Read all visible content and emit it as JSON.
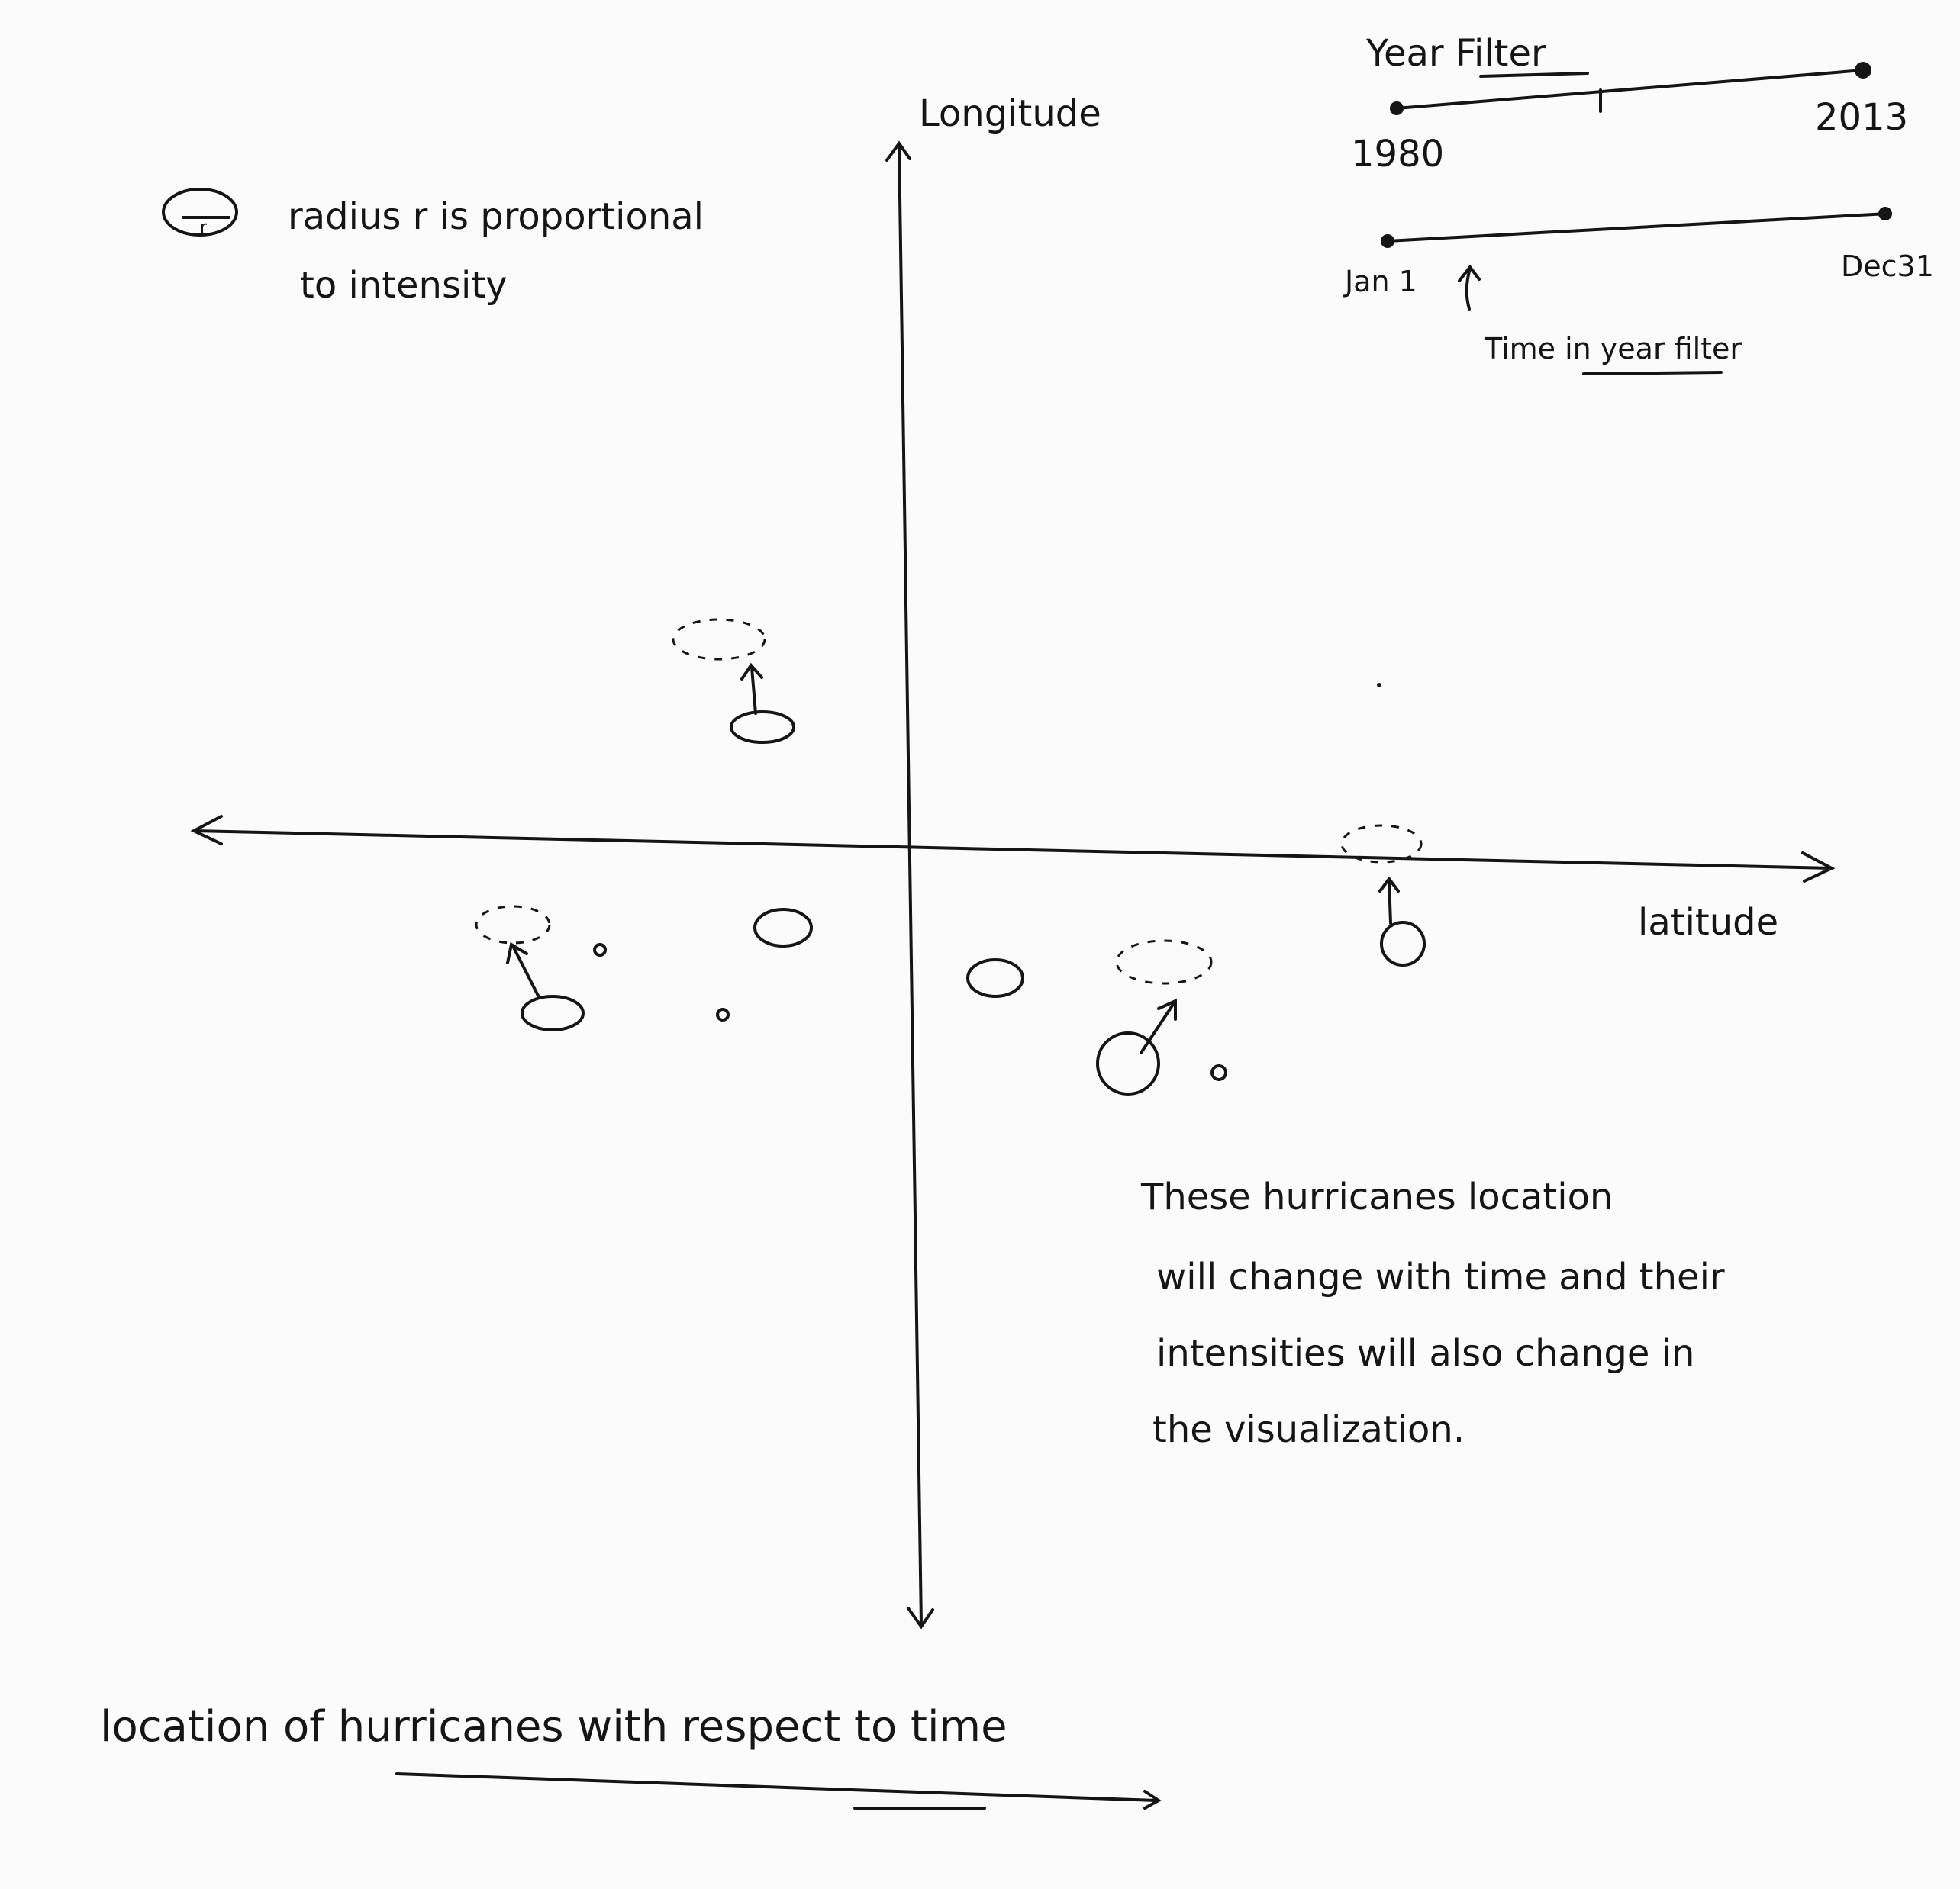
{
  "year_filter": {
    "title": "Year Filter",
    "start_label": "1980",
    "end_label": "2013"
  },
  "time_filter": {
    "start_label": "Jan 1",
    "end_label": "Dec31",
    "caption": "Time in year filter"
  },
  "legend": {
    "symbol_label": "r",
    "line1": "radius r is proportional",
    "line2": "to intensity"
  },
  "axes": {
    "y_label": "Longitude",
    "x_label": "latitude"
  },
  "note": {
    "lines": [
      "These hurricanes location",
      "will change with time and their",
      "intensities will also change in",
      "the visualization."
    ]
  },
  "caption": "location of hurricanes with respect to time"
}
